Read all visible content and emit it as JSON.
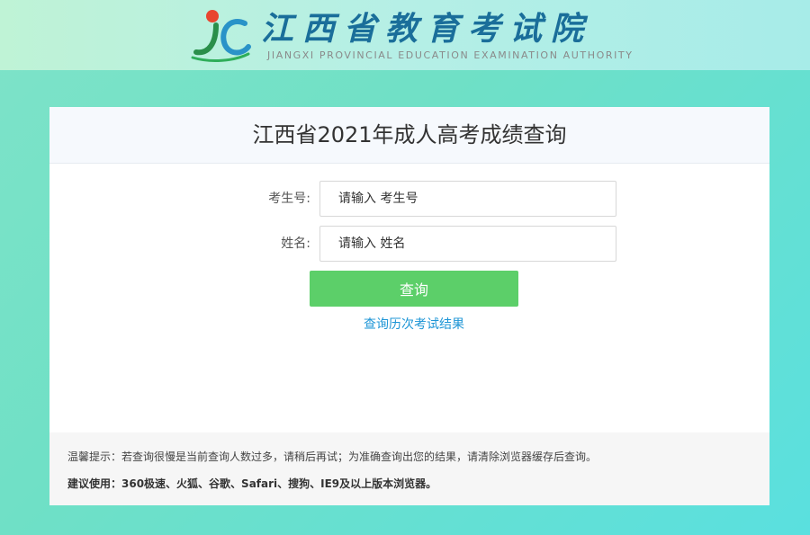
{
  "header": {
    "logo_cn": "江西省教育考试院",
    "logo_en": "JIANGXI PROVINCIAL EDUCATION EXAMINATION AUTHORITY",
    "logo_icon": "jxeea-logo-mark"
  },
  "card": {
    "title": "江西省2021年成人高考成绩查询",
    "fields": {
      "exam_no": {
        "label": "考生号:",
        "placeholder": "请输入 考生号",
        "value": ""
      },
      "name": {
        "label": "姓名:",
        "placeholder": "请输入 姓名",
        "value": ""
      }
    },
    "submit_label": "查询",
    "history_link": "查询历次考试结果"
  },
  "tips": {
    "line1": "温馨提示：若查询很慢是当前查询人数过多，请稍后再试；为准确查询出您的结果，请清除浏览器缓存后查询。",
    "line2": "建议使用：360极速、火狐、谷歌、Safari、搜狗、IE9及以上版本浏览器。"
  },
  "colors": {
    "button_green": "#5ccf69",
    "link_blue": "#1d95d6",
    "logo_blue": "#1a6e9a"
  }
}
